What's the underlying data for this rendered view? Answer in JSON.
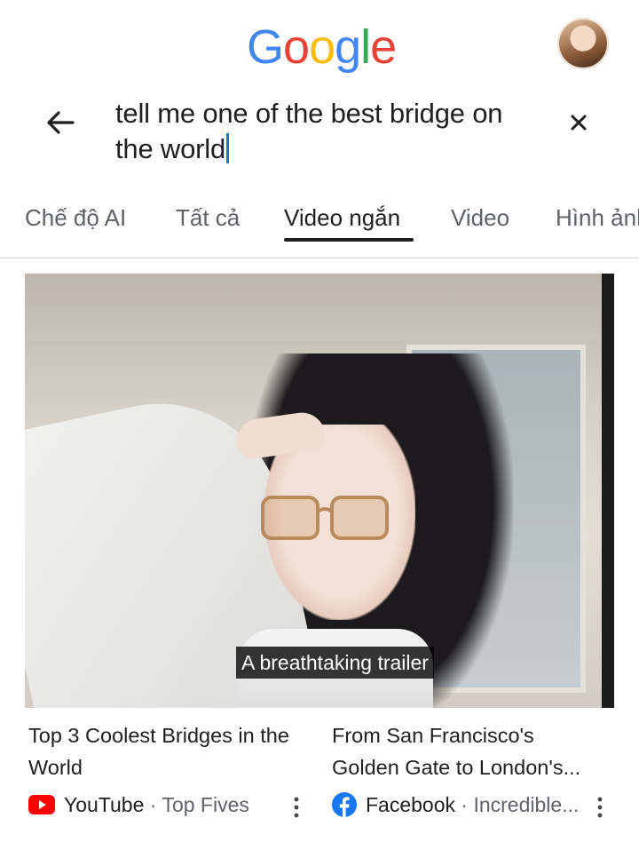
{
  "header": {
    "logo_letters": [
      {
        "char": "G",
        "color": "#4285F4"
      },
      {
        "char": "o",
        "color": "#EA4335"
      },
      {
        "char": "o",
        "color": "#FBBC05"
      },
      {
        "char": "g",
        "color": "#4285F4"
      },
      {
        "char": "l",
        "color": "#34A853"
      },
      {
        "char": "e",
        "color": "#EA4335"
      }
    ],
    "avatar_icon": "user-avatar"
  },
  "search": {
    "query_line1": "tell me one of the best bridge on",
    "query_line2": "the world",
    "back_icon": "arrow-left-icon",
    "clear_icon": "close-icon",
    "caret_color": "#1a73e8"
  },
  "tabs": [
    {
      "label": "Chế độ AI",
      "active": false
    },
    {
      "label": "Tất cả",
      "active": false
    },
    {
      "label": "Video ngắn",
      "active": true
    },
    {
      "label": "Video",
      "active": false
    },
    {
      "label": "Hình ảnh",
      "active": false
    }
  ],
  "video": {
    "caption": "A breathtaking trailer"
  },
  "results": [
    {
      "title_line1": "Top 3 Coolest Bridges in the",
      "title_line2": "World",
      "source": "YouTube",
      "separator": "·",
      "channel": "Top Fives",
      "source_icon": "youtube-icon",
      "brand_color": "#FF0000"
    },
    {
      "title_line1": "From San Francisco's",
      "title_line2": "Golden Gate to London's...",
      "source": "Facebook",
      "separator": "·",
      "channel": "Incredible...",
      "source_icon": "facebook-icon",
      "brand_color": "#1877F2"
    }
  ]
}
